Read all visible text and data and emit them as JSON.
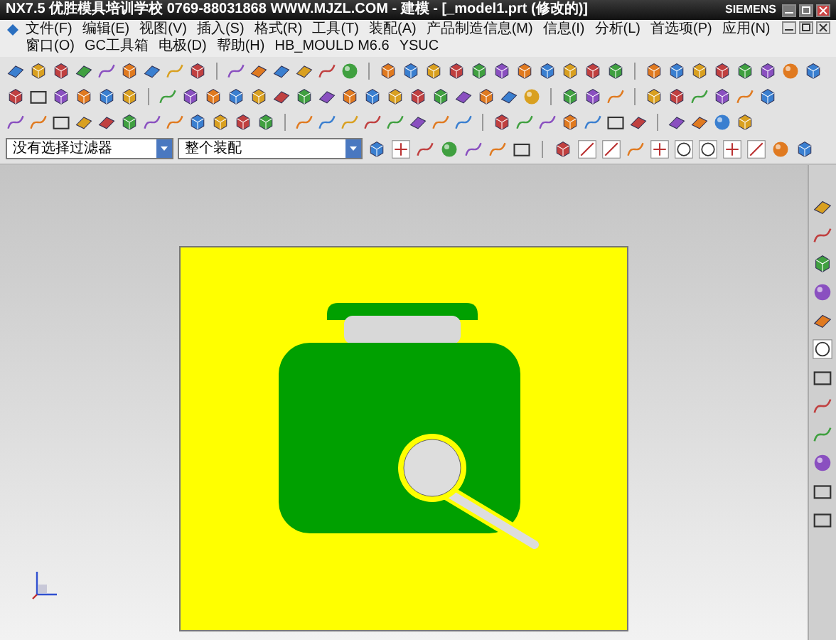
{
  "window": {
    "title": "NX7.5  优胜模具培训学校  0769-88031868  WWW.MJZL.COM - 建模 - [_model1.prt (修改的)]",
    "brand": "SIEMENS"
  },
  "menu": [
    "文件(F)",
    "编辑(E)",
    "视图(V)",
    "插入(S)",
    "格式(R)",
    "工具(T)",
    "装配(A)",
    "产品制造信息(M)",
    "信息(I)",
    "分析(L)",
    "首选项(P)",
    "应用(N)",
    "窗口(O)",
    "GC工具箱",
    "电极(D)",
    "帮助(H)",
    "HB_MOULD M6.6",
    "YSUC"
  ],
  "selection_bar": {
    "type_filter": "没有选择过滤器",
    "scope": "整个装配"
  }
}
